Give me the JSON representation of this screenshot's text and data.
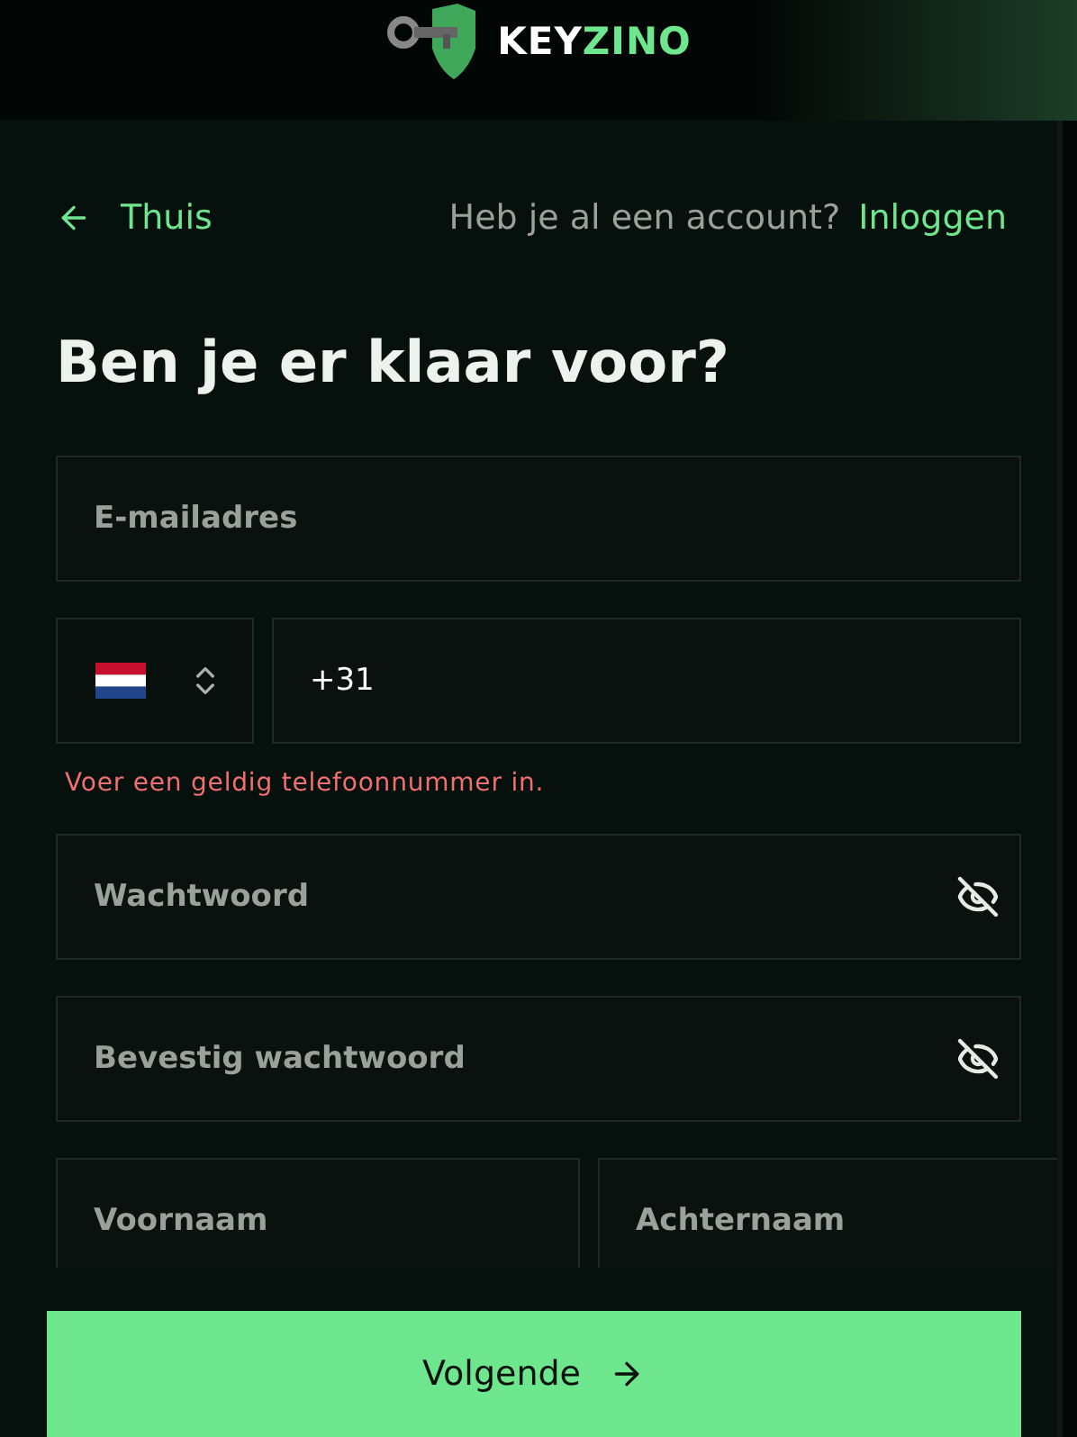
{
  "logo": {
    "primary": "KEY",
    "accent": "ZINO"
  },
  "nav": {
    "back_link": "Thuis",
    "account_prompt": "Heb je al een account?",
    "login_link": "Inloggen"
  },
  "heading": "Ben je er klaar voor?",
  "form": [
    {
      "kind": "text",
      "placeholder": "E-mailadres"
    },
    {
      "kind": "phone",
      "value": "+31",
      "error": "Voer een geldig telefoonnummer in."
    },
    {
      "kind": "password",
      "placeholder": "Wachtwoord",
      "revealed": false
    },
    {
      "kind": "password",
      "placeholder": "Bevestig wachtwoord",
      "revealed": false
    },
    {
      "kind": "pair",
      "fields": [
        {
          "placeholder": "Voornaam"
        },
        {
          "placeholder": "Achternaam"
        }
      ]
    }
  ],
  "submit": {
    "label": "Volgende"
  }
}
